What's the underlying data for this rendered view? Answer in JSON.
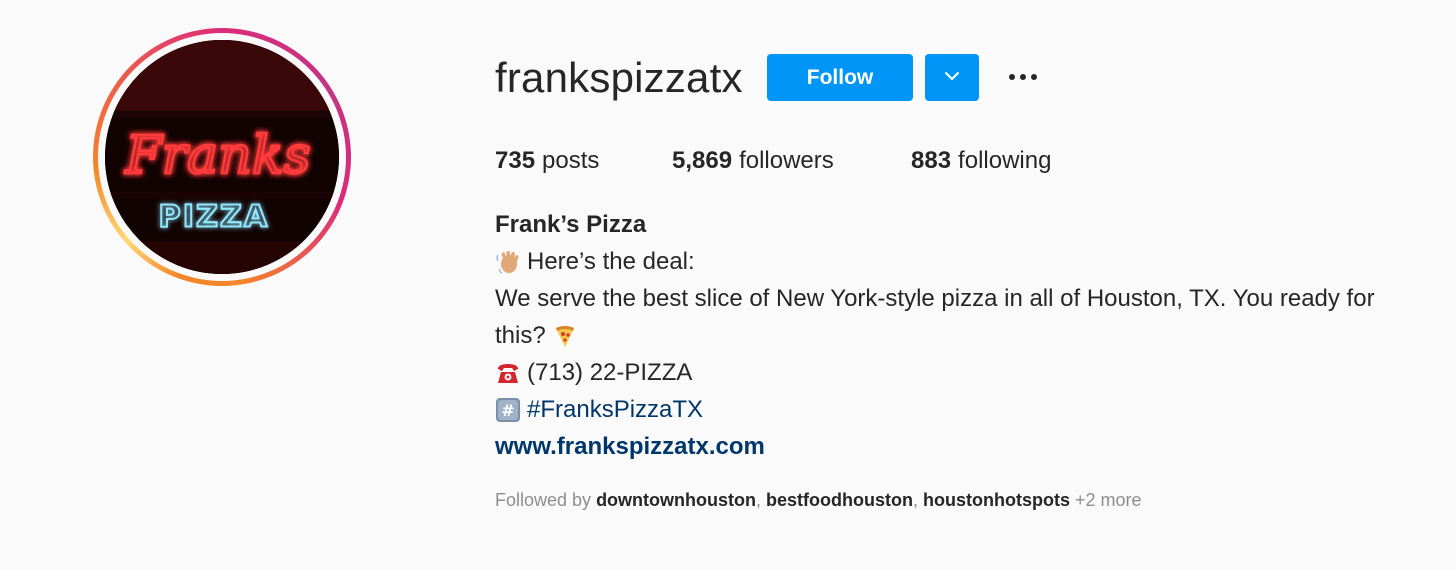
{
  "profile": {
    "username": "frankspizzatx",
    "follow_label": "Follow",
    "more_icon": "more-horizontal-icon",
    "dropdown_icon": "chevron-down-icon"
  },
  "stats": {
    "posts_count": "735",
    "posts_label": "posts",
    "followers_count": "5,869",
    "followers_label": "followers",
    "following_count": "883",
    "following_label": "following"
  },
  "avatar": {
    "sign_line1": "Franks",
    "sign_line2": "PIZZA"
  },
  "bio": {
    "name": "Frank’s Pizza",
    "line1": "Here’s the deal:",
    "line2": "We serve the best slice of New York-style pizza in all of Houston, TX. You ready for",
    "line3": "this?",
    "phone": "(713) 22-PIZZA",
    "hashtag": "#FranksPizzaTX",
    "website": "www.frankspizzatx.com"
  },
  "followed_by": {
    "prefix": "Followed by",
    "accounts": [
      "downtownhouston",
      "bestfoodhouston",
      "houstonhotspots"
    ],
    "more": "+2 more"
  },
  "colors": {
    "accent": "#0095f6",
    "link": "#00376b",
    "muted": "#8e8e8e",
    "text": "#262626"
  }
}
